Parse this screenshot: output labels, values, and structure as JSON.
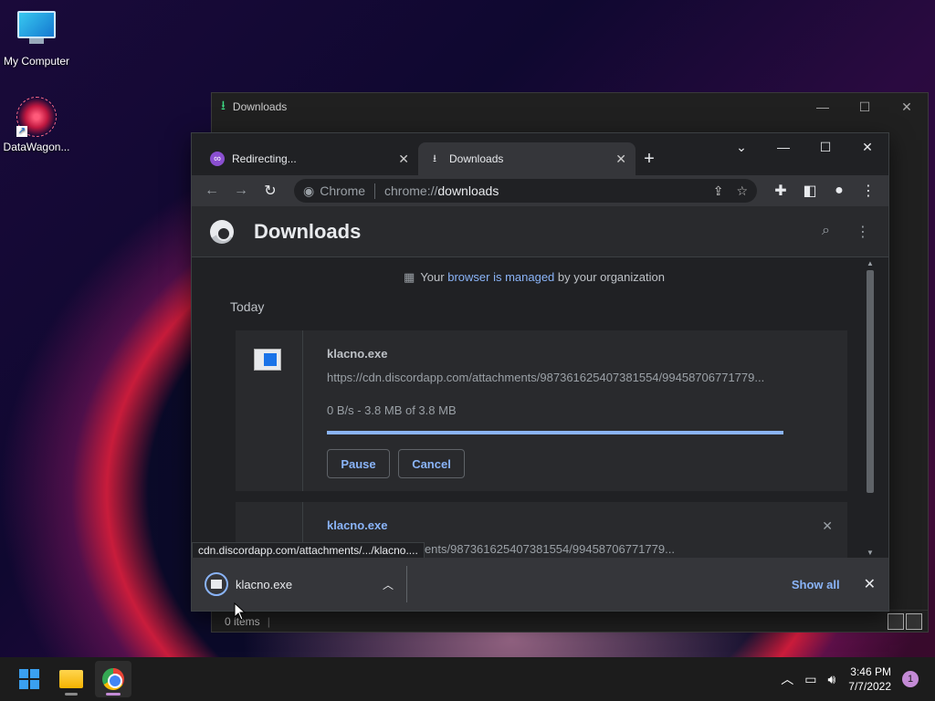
{
  "desktop": {
    "icons": [
      {
        "label": "My Computer"
      },
      {
        "label": "DataWagon..."
      }
    ]
  },
  "explorer": {
    "title": "Downloads",
    "status": "0 items"
  },
  "chrome": {
    "tabs": [
      {
        "label": "Redirecting..."
      },
      {
        "label": "Downloads"
      }
    ],
    "omnibox": {
      "chip": "Chrome",
      "scheme": "chrome://",
      "host": "downloads"
    },
    "page": {
      "title": "Downloads",
      "managed_prefix": "Your ",
      "managed_link": "browser is managed",
      "managed_suffix": " by your organization",
      "section": "Today"
    },
    "downloads": [
      {
        "name": "klacno.exe",
        "url": "https://cdn.discordapp.com/attachments/987361625407381554/99458706771779...",
        "status": "0 B/s - 3.8 MB of 3.8 MB",
        "progress": 1.0,
        "pause_label": "Pause",
        "cancel_label": "Cancel"
      },
      {
        "name": "klacno.exe",
        "url": "dapp.com/attachments/987361625407381554/99458706771779..."
      }
    ],
    "status_tooltip": "cdn.discordapp.com/attachments/.../klacno....",
    "shelf": {
      "item_name": "klacno.exe",
      "show_all": "Show all"
    }
  },
  "taskbar": {
    "time": "3:46 PM",
    "date": "7/7/2022",
    "notification_count": "1"
  }
}
